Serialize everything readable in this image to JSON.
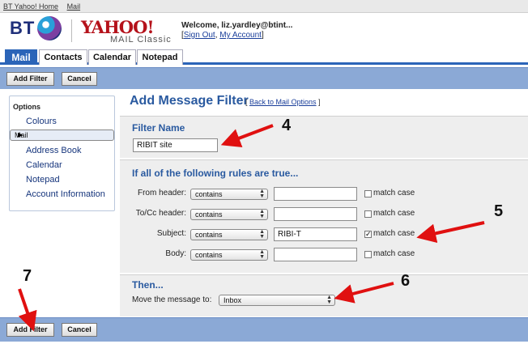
{
  "topbar": {
    "link_home": "BT Yahoo! Home",
    "link_mail": "Mail"
  },
  "header": {
    "bt_logo": "BT",
    "yahoo_logo": "YAHOO!",
    "mail_classic": "MAIL Classic",
    "welcome": "Welcome, liz.yardley@btint...",
    "sign_out": "Sign Out",
    "my_account": "My Account"
  },
  "tabs": [
    {
      "label": "Mail"
    },
    {
      "label": "Contacts"
    },
    {
      "label": "Calendar"
    },
    {
      "label": "Notepad"
    }
  ],
  "toolbar": {
    "add_filter": "Add Filter",
    "cancel": "Cancel"
  },
  "sidebar": {
    "title": "Options",
    "items": [
      {
        "label": "Colours"
      },
      {
        "label": "Mail"
      },
      {
        "label": "Address Book"
      },
      {
        "label": "Calendar"
      },
      {
        "label": "Notepad"
      },
      {
        "label": "Account Information"
      }
    ]
  },
  "main": {
    "heading": "Add Message Filter",
    "back_link": "Back to Mail Options",
    "filter_name": {
      "label": "Filter Name",
      "value": "RIBIT site"
    },
    "rules": {
      "title": "If all of the following rules are true...",
      "rows": [
        {
          "label": "From header:",
          "operator": "contains",
          "value": "",
          "match_case": "match case",
          "checked": false
        },
        {
          "label": "To/Cc header:",
          "operator": "contains",
          "value": "",
          "match_case": "match case",
          "checked": false
        },
        {
          "label": "Subject:",
          "operator": "contains",
          "value": "RIBI-T",
          "match_case": "match case",
          "checked": true
        },
        {
          "label": "Body:",
          "operator": "contains",
          "value": "",
          "match_case": "match case",
          "checked": false
        }
      ]
    },
    "then": {
      "title": "Then...",
      "move_label": "Move the message to:",
      "folder": "Inbox"
    }
  },
  "annotations": {
    "n4": "4",
    "n5": "5",
    "n6": "6",
    "n7": "7"
  },
  "colors": {
    "accent": "#2b64b8",
    "toolbar": "#8ba9d6",
    "arrow": "#e01010",
    "heading": "#2a5aa0"
  }
}
